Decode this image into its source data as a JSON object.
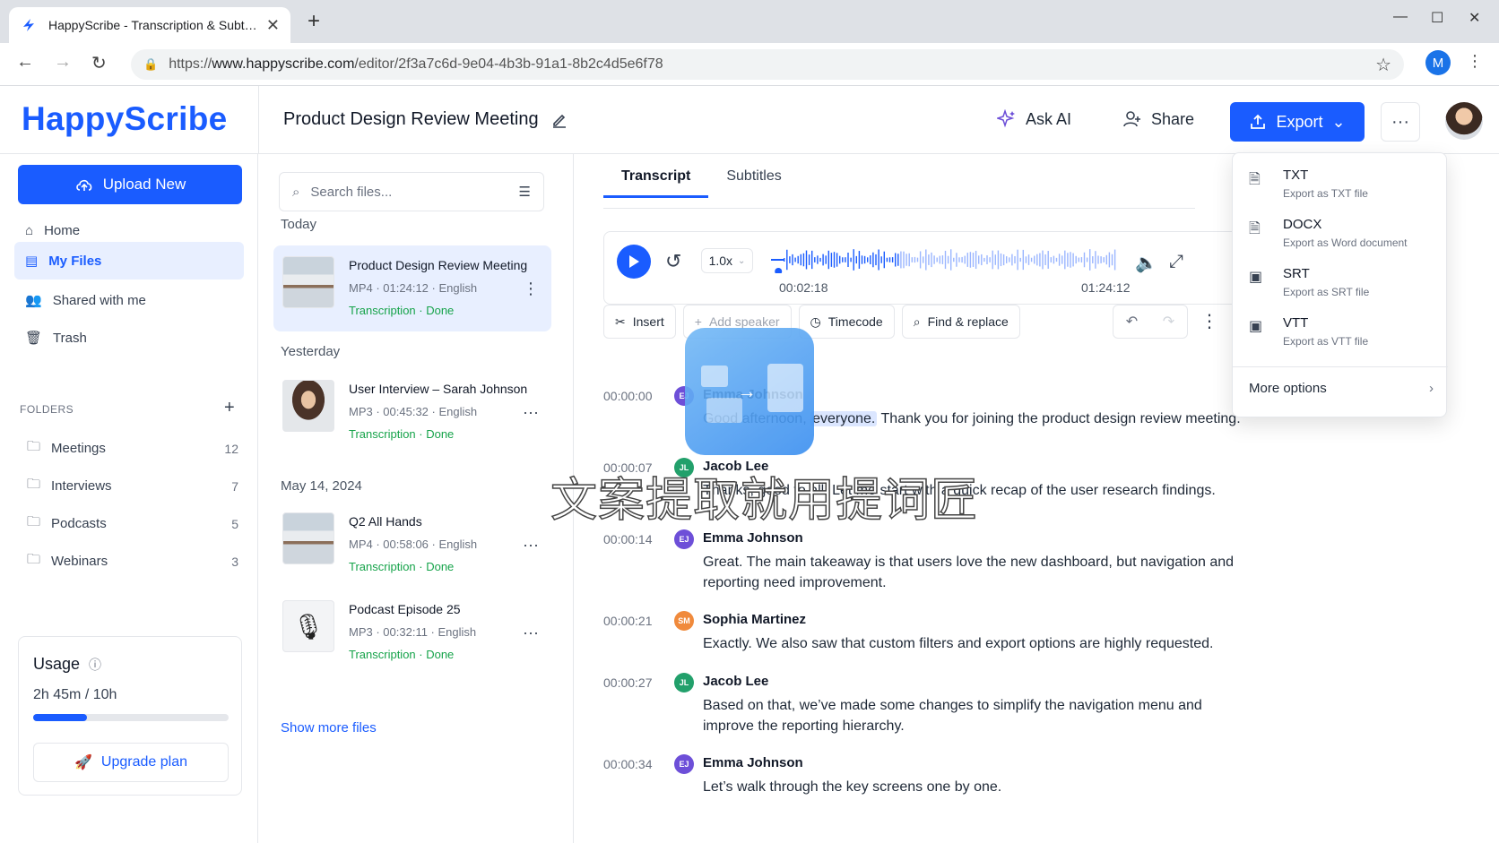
{
  "browser": {
    "tab_title": "HappyScribe - Transcription & Subtitles",
    "url_prefix": "https://",
    "url_domain": "www.happyscribe.com",
    "url_path": "/editor/2f3a7c6d-9e04-4b3b-91a1-8b2c4d5e6f78",
    "profile_initial": "M"
  },
  "header": {
    "logo": "HappyScribe",
    "doc_title": "Product Design Review Meeting",
    "ask_ai": "Ask AI",
    "share": "Share",
    "export": "Export"
  },
  "sidebar": {
    "upload": "Upload New",
    "nav": [
      {
        "label": "Home",
        "icon": "home-icon"
      },
      {
        "label": "My Files",
        "icon": "file-icon",
        "active": true
      },
      {
        "label": "Shared with me",
        "icon": "users-icon"
      },
      {
        "label": "Trash",
        "icon": "trash-icon"
      }
    ],
    "folders_title": "FOLDERS",
    "folders": [
      {
        "name": "Meetings",
        "count": "12"
      },
      {
        "name": "Interviews",
        "count": "7"
      },
      {
        "name": "Podcasts",
        "count": "5"
      },
      {
        "name": "Webinars",
        "count": "3"
      }
    ],
    "usage": {
      "title": "Usage",
      "value": "2h 45m / 10h",
      "fraction": 0.275,
      "upgrade": "Upgrade plan"
    }
  },
  "files": {
    "search_placeholder": "Search files...",
    "groups": [
      {
        "label": "Today"
      },
      {
        "label": "Yesterday"
      },
      {
        "label": "May 14, 2024"
      }
    ],
    "items": [
      {
        "name": "Product Design Review Meeting",
        "format": "MP4",
        "duration": "01:24:12",
        "language": "English",
        "status": "Transcription · Done"
      },
      {
        "name": "User Interview – Sarah Johnson",
        "format": "MP3",
        "duration": "00:45:32",
        "language": "English",
        "status": "Transcription · Done"
      },
      {
        "name": "Q2 All Hands",
        "format": "MP4",
        "duration": "00:58:06",
        "language": "English",
        "status": "Transcription · Done"
      },
      {
        "name": "Podcast Episode 25",
        "format": "MP3",
        "duration": "00:32:11",
        "language": "English",
        "status": "Transcription · Done"
      }
    ],
    "show_more": "Show more files"
  },
  "editor": {
    "tabs": [
      "Transcript",
      "Subtitles"
    ],
    "player": {
      "speed": "1.0x",
      "current": "00:02:18",
      "total": "01:24:12",
      "progress": 0.027
    },
    "toolbar": {
      "insert": "Insert",
      "add_speaker": "Add speaker",
      "timecode": "Timecode",
      "find_replace": "Find & replace"
    },
    "segments": [
      {
        "time": "00:00:00",
        "initials": "EJ",
        "color": "#6d4fd8",
        "speaker": "Emma Johnson",
        "pre": "Good afternoon, ",
        "highlight": "everyone.",
        "post": " Thank you for joining the product design review meeting."
      },
      {
        "time": "00:00:07",
        "initials": "JL",
        "color": "#22a06b",
        "speaker": "Jacob Lee",
        "pre": "Thanks, good to all. Let me start with a quick recap of the user research findings.",
        "highlight": "",
        "post": ""
      },
      {
        "time": "00:00:14",
        "initials": "EJ",
        "color": "#6d4fd8",
        "speaker": "Emma Johnson",
        "pre": "Great. The main takeaway is that users love the new dashboard, but navigation and reporting need improvement.",
        "highlight": "",
        "post": ""
      },
      {
        "time": "00:00:21",
        "initials": "SM",
        "color": "#f08a3c",
        "speaker": "Sophia Martinez",
        "pre": "Exactly. We also saw that custom filters and export options are highly requested.",
        "highlight": "",
        "post": ""
      },
      {
        "time": "00:00:27",
        "initials": "JL",
        "color": "#22a06b",
        "speaker": "Jacob Lee",
        "pre": "Based on that, we’ve made some changes to simplify the navigation menu and improve the reporting hierarchy.",
        "highlight": "",
        "post": ""
      },
      {
        "time": "00:00:34",
        "initials": "EJ",
        "color": "#6d4fd8",
        "speaker": "Emma Johnson",
        "pre": "Let’s walk through the key screens one by one.",
        "highlight": "",
        "post": ""
      }
    ]
  },
  "export_menu": {
    "items": [
      {
        "name": "TXT",
        "desc": "Export as TXT file"
      },
      {
        "name": "DOCX",
        "desc": "Export as Word document"
      },
      {
        "name": "SRT",
        "desc": "Export as SRT file"
      },
      {
        "name": "VTT",
        "desc": "Export as VTT file"
      }
    ],
    "more": "More options"
  },
  "watermark": "文案提取就用提词匠",
  "colors": {
    "brand": "#1a5cff",
    "done": "#16a34a"
  }
}
